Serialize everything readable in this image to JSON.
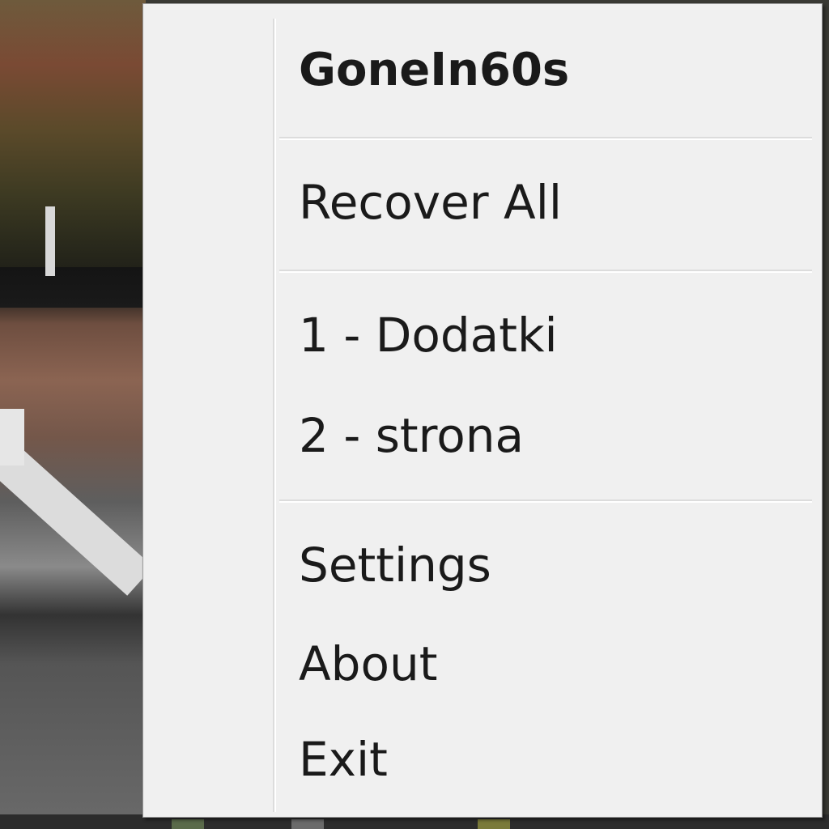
{
  "context_menu": {
    "title": "GoneIn60s",
    "items": [
      "Recover All",
      "1 - Dodatki",
      "2 - strona",
      "Settings",
      "About",
      "Exit"
    ]
  }
}
